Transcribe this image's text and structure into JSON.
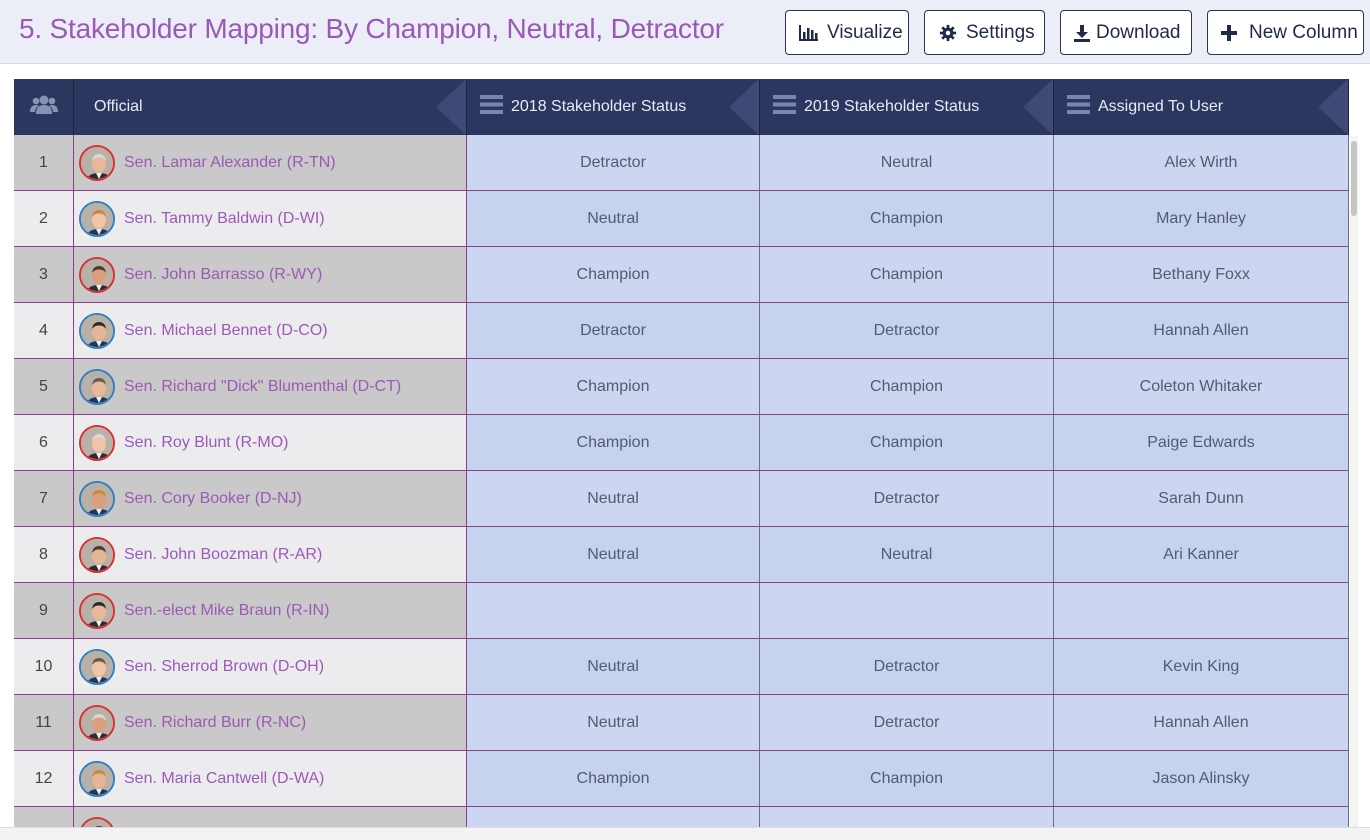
{
  "page": {
    "title": "5. Stakeholder Mapping: By Champion, Neutral, Detractor"
  },
  "toolbar": {
    "visualize": "Visualize",
    "settings": "Settings",
    "download": "Download",
    "new_column": "New Column"
  },
  "columns": {
    "group_icon": "users-icon",
    "official": "Official",
    "status_2018": "2018 Stakeholder Status",
    "status_2019": "2019 Stakeholder Status",
    "assigned": "Assigned To User"
  },
  "colors": {
    "title": "#9b59b6",
    "header_bg": "#2c3760",
    "row_border": "#8b3f8f",
    "republican_ring": "#d93030",
    "democrat_ring": "#2f7fc1"
  },
  "rows": [
    {
      "num": "1",
      "name": "Sen. Lamar Alexander (R-TN)",
      "party": "R",
      "s2018": "Detractor",
      "s2019": "Neutral",
      "user": "Alex Wirth"
    },
    {
      "num": "2",
      "name": "Sen. Tammy Baldwin (D-WI)",
      "party": "D",
      "s2018": "Neutral",
      "s2019": "Champion",
      "user": "Mary Hanley"
    },
    {
      "num": "3",
      "name": "Sen. John Barrasso (R-WY)",
      "party": "R",
      "s2018": "Champion",
      "s2019": "Champion",
      "user": "Bethany Foxx"
    },
    {
      "num": "4",
      "name": "Sen. Michael Bennet (D-CO)",
      "party": "D",
      "s2018": "Detractor",
      "s2019": "Detractor",
      "user": "Hannah Allen"
    },
    {
      "num": "5",
      "name": "Sen. Richard \"Dick\" Blumenthal (D-CT)",
      "party": "D",
      "s2018": "Champion",
      "s2019": "Champion",
      "user": "Coleton Whitaker"
    },
    {
      "num": "6",
      "name": "Sen. Roy Blunt (R-MO)",
      "party": "R",
      "s2018": "Champion",
      "s2019": "Champion",
      "user": "Paige Edwards"
    },
    {
      "num": "7",
      "name": "Sen. Cory Booker (D-NJ)",
      "party": "D",
      "s2018": "Neutral",
      "s2019": "Detractor",
      "user": "Sarah Dunn"
    },
    {
      "num": "8",
      "name": "Sen. John Boozman (R-AR)",
      "party": "R",
      "s2018": "Neutral",
      "s2019": "Neutral",
      "user": "Ari Kanner"
    },
    {
      "num": "9",
      "name": "Sen.-elect Mike Braun (R-IN)",
      "party": "R",
      "s2018": "",
      "s2019": "",
      "user": ""
    },
    {
      "num": "10",
      "name": "Sen. Sherrod Brown (D-OH)",
      "party": "D",
      "s2018": "Neutral",
      "s2019": "Detractor",
      "user": "Kevin King"
    },
    {
      "num": "11",
      "name": "Sen. Richard Burr (R-NC)",
      "party": "R",
      "s2018": "Neutral",
      "s2019": "Detractor",
      "user": "Hannah Allen"
    },
    {
      "num": "12",
      "name": "Sen. Maria Cantwell (D-WA)",
      "party": "D",
      "s2018": "Champion",
      "s2019": "Champion",
      "user": "Jason Alinsky"
    },
    {
      "num": "",
      "name": "",
      "party": "R",
      "s2018": "",
      "s2019": "",
      "user": ""
    }
  ]
}
